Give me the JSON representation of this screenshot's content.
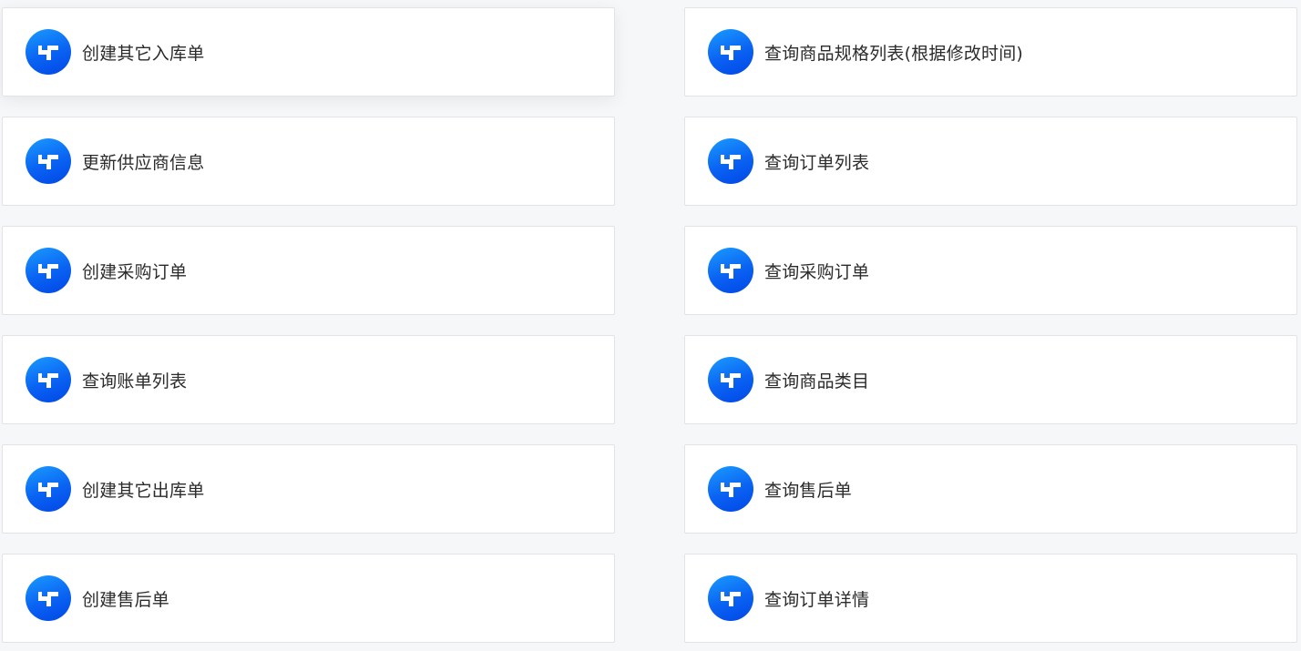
{
  "colors": {
    "logo_start": "#1a9bff",
    "logo_end": "#0047e6",
    "card_border": "#e1e3e8",
    "page_background": "#f6f7f9",
    "text": "#2b2b2b"
  },
  "app_icon": "brand-logo-icon",
  "items": [
    {
      "label": "创建其它入库单",
      "column": "left"
    },
    {
      "label": "查询商品规格列表(根据修改时间)",
      "column": "right"
    },
    {
      "label": "更新供应商信息",
      "column": "left"
    },
    {
      "label": "查询订单列表",
      "column": "right"
    },
    {
      "label": "创建采购订单",
      "column": "left"
    },
    {
      "label": "查询采购订单",
      "column": "right"
    },
    {
      "label": "查询账单列表",
      "column": "left"
    },
    {
      "label": "查询商品类目",
      "column": "right"
    },
    {
      "label": "创建其它出库单",
      "column": "left"
    },
    {
      "label": "查询售后单",
      "column": "right"
    },
    {
      "label": "创建售后单",
      "column": "left"
    },
    {
      "label": "查询订单详情",
      "column": "right"
    }
  ]
}
